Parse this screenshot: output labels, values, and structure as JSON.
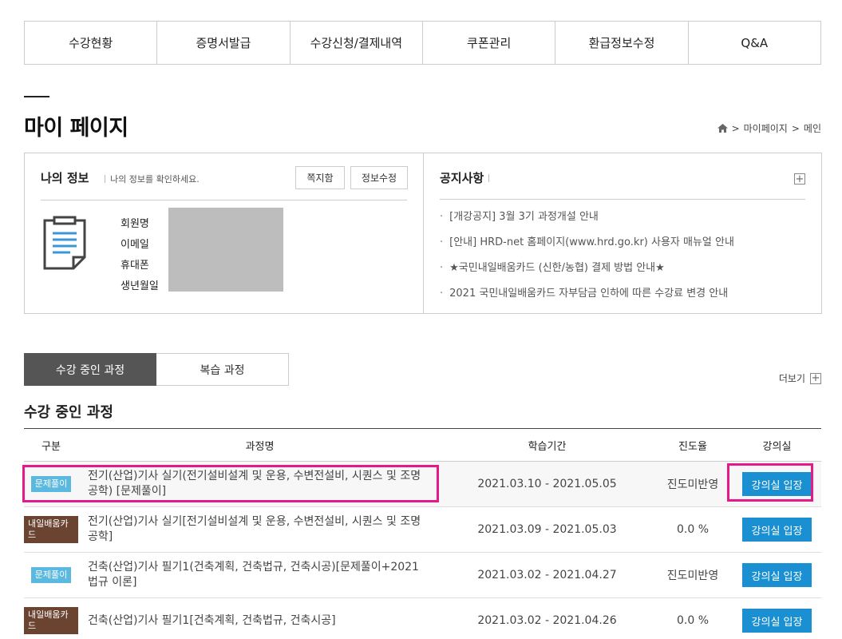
{
  "nav": [
    "수강현황",
    "증명서발급",
    "수강신청/결제내역",
    "쿠폰관리",
    "환급정보수정",
    "Q&A"
  ],
  "page_title": "마이 페이지",
  "breadcrumb": {
    "home_icon": "home-icon",
    "items": [
      "마이페이지",
      "메인"
    ]
  },
  "my_info": {
    "title": "나의 정보",
    "subtitle": "나의 정보를 확인하세요.",
    "btn_message": "쪽지함",
    "btn_edit": "정보수정",
    "fields": [
      "회원명",
      "이메일",
      "휴대폰",
      "생년월일"
    ]
  },
  "notice": {
    "title": "공지사항",
    "items": [
      "[개강공지] 3월 3기 과정개설 안내",
      "[안내] HRD-net 홈페이지(www.hrd.go.kr) 사용자 매뉴얼 안내",
      "★국민내일배움카드 (신한/농협) 결제 방법 안내★",
      "2021 국민내일배움카드 자부담금 인하에 따른 수강료 변경 안내"
    ]
  },
  "tabs": [
    "수강 중인 과정",
    "복습 과정"
  ],
  "more_label": "더보기",
  "section_title": "수강 중인 과정",
  "table": {
    "headers": [
      "구분",
      "과정명",
      "학습기간",
      "진도율",
      "강의실"
    ],
    "rows": [
      {
        "type": "문제풀이",
        "type_color": "blue",
        "course": "전기(산업)기사 실기(전기설비설계 및 운용, 수변전설비, 시퀀스 및 조명공학) [문제풀이]",
        "period": "2021.03.10 - 2021.05.05",
        "progress": "진도미반영",
        "button": "강의실 입장"
      },
      {
        "type": "내일배움카드",
        "type_color": "brown",
        "course": "전기(산업)기사 실기[전기설비설계 및 운용, 수변전설비, 시퀀스 및 조명공학]",
        "period": "2021.03.09 - 2021.05.03",
        "progress": "0.0 %",
        "button": "강의실 입장"
      },
      {
        "type": "문제풀이",
        "type_color": "blue",
        "course": "건축(산업)기사 필기1(건축계획, 건축법규, 건축시공)[문제풀이+2021법규 이론]",
        "period": "2021.03.02 - 2021.04.27",
        "progress": "진도미반영",
        "button": "강의실 입장"
      },
      {
        "type": "내일배움카드",
        "type_color": "brown",
        "course": "건축(산업)기사 필기1[건축계획, 건축법규, 건축시공]",
        "period": "2021.03.02 - 2021.04.26",
        "progress": "0.0 %",
        "button": "강의실 입장"
      }
    ]
  }
}
